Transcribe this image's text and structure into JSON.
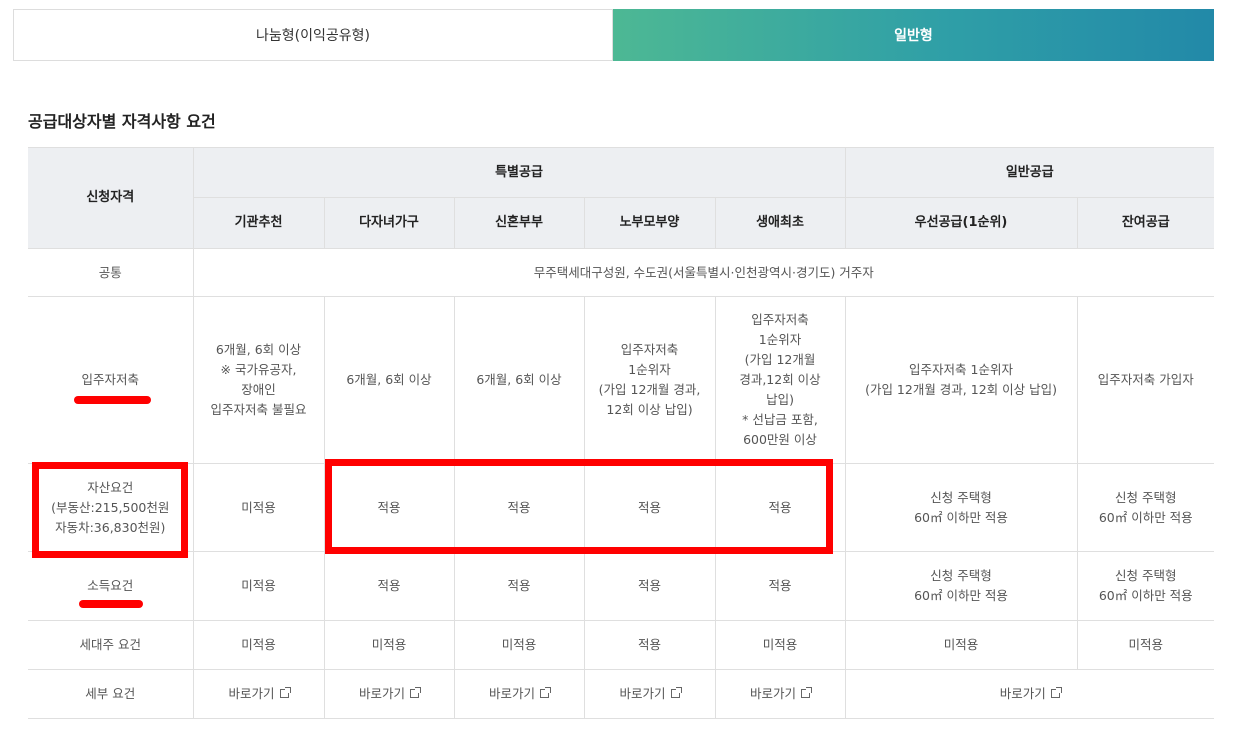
{
  "tabs": {
    "sharing": "나눔형(이익공유형)",
    "general": "일반형"
  },
  "section_title": "공급대상자별 자격사항 요건",
  "table": {
    "header": {
      "qualification": "신청자격",
      "special": "특별공급",
      "general": "일반공급",
      "cols": [
        "기관추천",
        "다자녀가구",
        "신혼부부",
        "노부모부양",
        "생애최초",
        "우선공급(1순위)",
        "잔여공급"
      ]
    },
    "rows": {
      "common": {
        "label": "공통",
        "value": "무주택세대구성원, 수도권(서울특별시·인천광역시·경기도) 거주자"
      },
      "savings": {
        "label": "입주자저축",
        "cells": [
          "6개월, 6회 이상\n※ 국가유공자,\n장애인\n입주자저축 불필요",
          "6개월, 6회 이상",
          "6개월, 6회 이상",
          "입주자저축\n1순위자\n(가입 12개월 경과,\n12회 이상 납입)",
          "입주자저축\n1순위자\n(가입 12개월\n경과,12회 이상\n납입)\n* 선납금 포함,\n600만원 이상",
          "입주자저축 1순위자\n(가입 12개월 경과, 12회 이상 납입)",
          "입주자저축 가입자"
        ]
      },
      "assets": {
        "label": "자산요건\n(부동산:215,500천원\n자동차:36,830천원)",
        "cells": [
          "미적용",
          "적용",
          "적용",
          "적용",
          "적용",
          "신청 주택형\n60㎡ 이하만 적용",
          "신청 주택형\n60㎡ 이하만 적용"
        ]
      },
      "income": {
        "label": "소득요건",
        "cells": [
          "미적용",
          "적용",
          "적용",
          "적용",
          "적용",
          "신청 주택형\n60㎡ 이하만 적용",
          "신청 주택형\n60㎡ 이하만 적용"
        ]
      },
      "householder": {
        "label": "세대주 요건",
        "cells": [
          "미적용",
          "미적용",
          "미적용",
          "적용",
          "미적용",
          "미적용",
          "미적용"
        ]
      },
      "details": {
        "label": "세부 요건",
        "links": [
          "바로가기",
          "바로가기",
          "바로가기",
          "바로가기",
          "바로가기",
          "바로가기"
        ]
      }
    }
  },
  "colors": {
    "tab_gradient_start": "#4db894",
    "tab_gradient_end": "#2289a8",
    "header_bg": "#edeff2",
    "annotation": "#ff0000"
  },
  "icons": {
    "link": "external-link-icon"
  }
}
